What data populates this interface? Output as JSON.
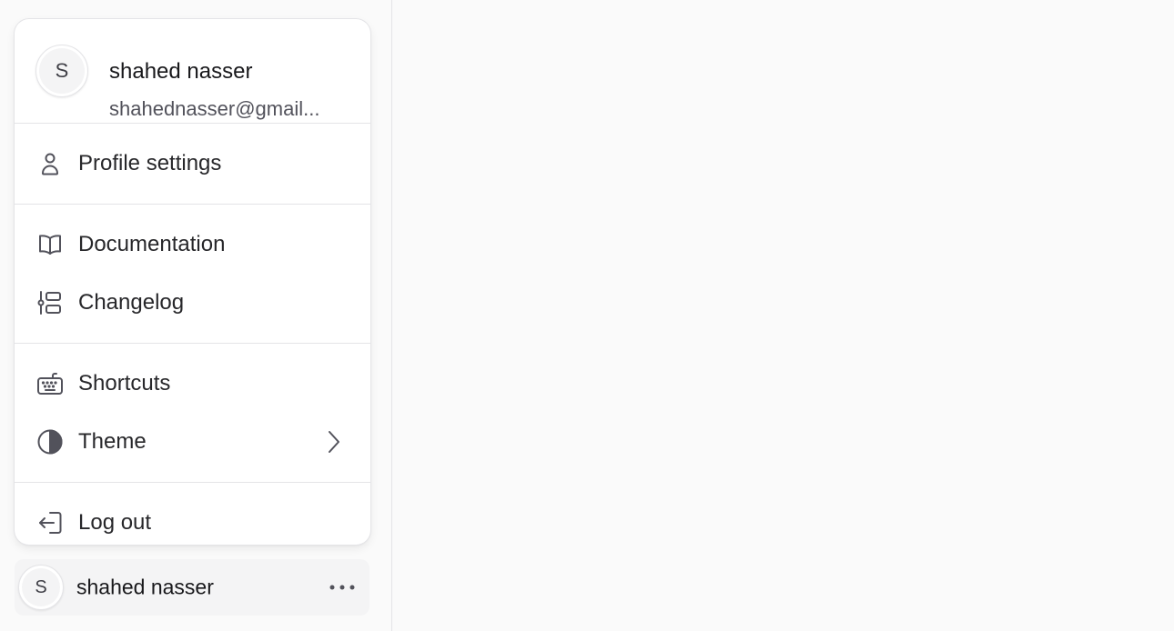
{
  "menu": {
    "user": {
      "avatar_initial": "S",
      "name": "shahed nasser",
      "email": "shahednasser@gmail..."
    },
    "groups": [
      [
        {
          "label": "Profile settings",
          "icon": "user-icon"
        }
      ],
      [
        {
          "label": "Documentation",
          "icon": "book-icon"
        },
        {
          "label": "Changelog",
          "icon": "timeline-icon"
        }
      ],
      [
        {
          "label": "Shortcuts",
          "icon": "keyboard-icon"
        },
        {
          "label": "Theme",
          "icon": "half-circle-icon",
          "has_submenu": true
        }
      ],
      [
        {
          "label": "Log out",
          "icon": "logout-icon"
        }
      ]
    ]
  },
  "footer": {
    "avatar_initial": "S",
    "name": "shahed nasser",
    "more_icon": "ellipsis-icon"
  },
  "colors": {
    "background": "#fafafa",
    "menu_bg": "#ffffff",
    "border": "#e4e4e7",
    "text": "#18181b",
    "muted_text": "#52525b"
  }
}
